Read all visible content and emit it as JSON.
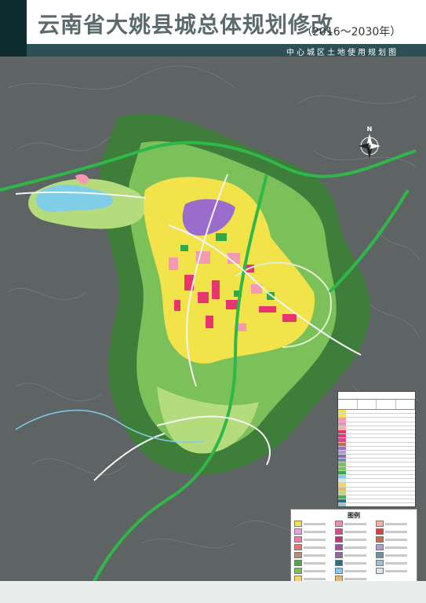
{
  "header": {
    "title": "云南省大姚县城总体规划修改",
    "years": "（2016～2030年）",
    "subtitle": "中心城区土地使用规划图"
  },
  "map": {
    "north_label": "N",
    "legend_title": "图例",
    "colors": {
      "background": "#5e6464",
      "forest": "#3f7d3a",
      "green_land": "#7cc05a",
      "light_green": "#b4dc7c",
      "residential": "#f2e34a",
      "commercial": "#e8356f",
      "industrial": "#9a6ccc",
      "public": "#f29ab0",
      "water": "#7fcde6",
      "road": "#f4f4f4",
      "highway": "#2fb84a"
    },
    "legend_swatches": [
      "#f2e34a",
      "#e88fb3",
      "#f6b2a1",
      "#e9a0e6",
      "#d94a8d",
      "#e03a3a",
      "#f07aa8",
      "#c2337a",
      "#c86b4a",
      "#e57373",
      "#a64ca6",
      "#ad9ecb",
      "#b38f7a",
      "#8c6aa8",
      "#6f8fa6",
      "#4fa84a",
      "#2d6f7c",
      "#9fc0cf",
      "#7cc05a",
      "#7fcde6",
      "#d9e4ea",
      "#f6d46a",
      "#e6b86a"
    ]
  }
}
